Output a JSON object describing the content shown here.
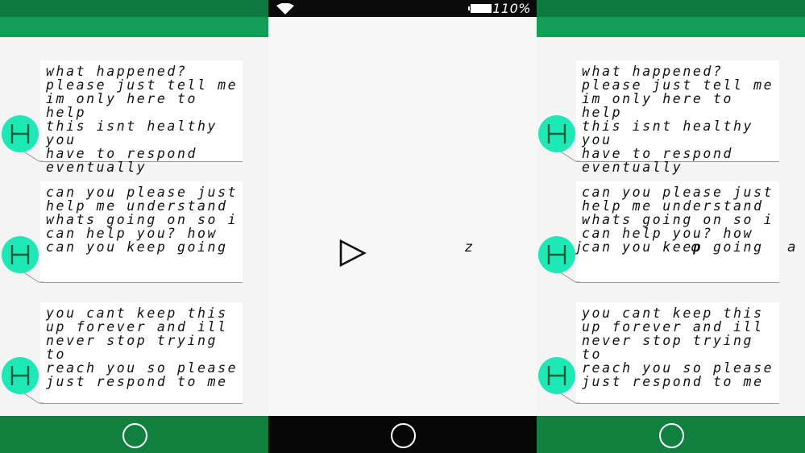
{
  "status_bar": {
    "battery_percent": "110%"
  },
  "messages": [
    {
      "avatar_letter": "H",
      "text": "what happened?\nplease just tell me\nim only here to help\nthis isnt healthy you\nhave to respond\neventually"
    },
    {
      "avatar_letter": "H",
      "text": "can you please just\nhelp me understand\nwhats going on so i\ncan help you? how\ncan you keep going"
    },
    {
      "avatar_letter": "H",
      "text": "you cant keep this\nup forever and ill\nnever stop trying to\nreach you so please\njust respond to me"
    }
  ],
  "player": {
    "caption": "z"
  },
  "right_overlay": {
    "left_char": "j",
    "mid_char": "φ",
    "right_char": "a"
  },
  "colors": {
    "accent": "#1de9b6",
    "bar_dark": "#0f7a3f",
    "bar_light": "#139e57"
  }
}
